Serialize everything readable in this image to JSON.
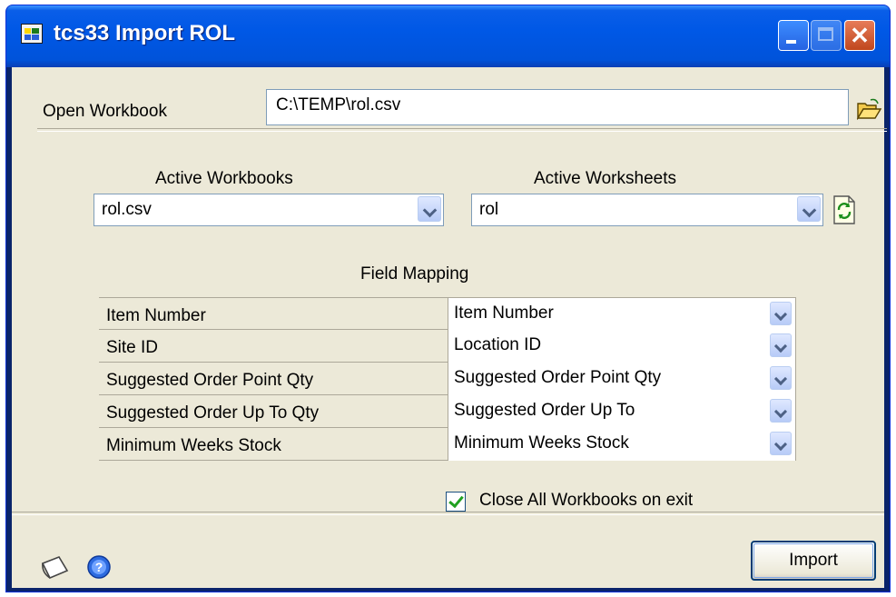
{
  "window": {
    "title": "tcs33 Import ROL",
    "controls": {
      "minimize": "minimize",
      "maximize": "maximize",
      "close": "close"
    }
  },
  "open_workbook": {
    "label": "Open Workbook",
    "path": "C:\\TEMP\\rol.csv",
    "browse_icon": "open-folder-icon"
  },
  "active_workbooks": {
    "label": "Active Workbooks",
    "selected": "rol.csv"
  },
  "active_worksheets": {
    "label": "Active Worksheets",
    "selected": "rol",
    "refresh_icon": "refresh-icon"
  },
  "field_mapping": {
    "title": "Field Mapping",
    "rows": [
      {
        "field": "Item Number",
        "mapped": "Item Number"
      },
      {
        "field": "Site ID",
        "mapped": "Location ID"
      },
      {
        "field": "Suggested Order Point Qty",
        "mapped": "Suggested Order Point Qty"
      },
      {
        "field": "Suggested Order Up To Qty",
        "mapped": "Suggested Order Up To"
      },
      {
        "field": "Minimum Weeks Stock",
        "mapped": "Minimum Weeks Stock"
      }
    ]
  },
  "close_all": {
    "label": "Close All Workbooks on exit",
    "checked": true
  },
  "footer": {
    "note_icon": "note-icon",
    "help_icon": "help-icon",
    "import_label": "Import"
  }
}
